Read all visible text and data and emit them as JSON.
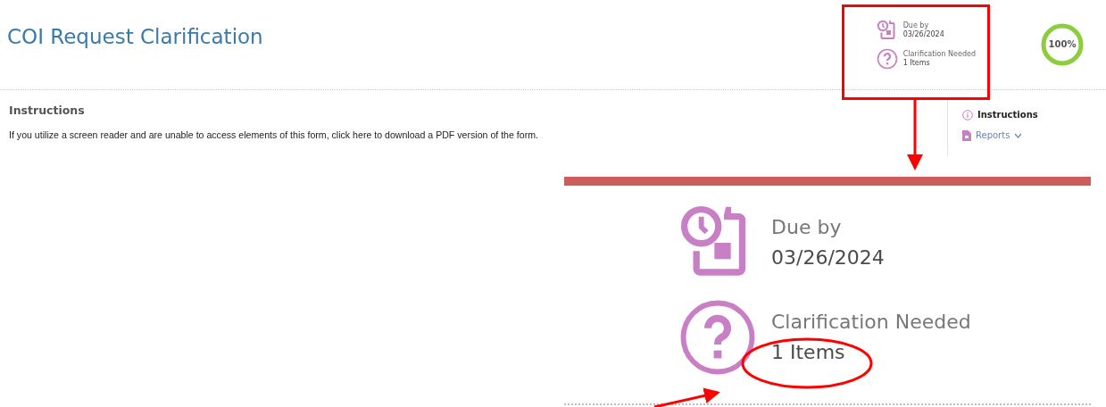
{
  "page": {
    "title": "COI Request Clarification"
  },
  "status": [
    {
      "kind": "due",
      "label": "Due by",
      "value": "03/26/2024"
    },
    {
      "kind": "clarification",
      "label": "Clarification Needed",
      "value": "1 Items"
    }
  ],
  "progress": {
    "label": "100%",
    "level": 1
  },
  "instructions": {
    "heading": "Instructions",
    "text": "If you utilize a screen reader and are unable to access elements of this form, click here to download a PDF version of the form."
  },
  "sidebar": {
    "items": [
      {
        "kind": "info",
        "label": "Instructions",
        "selected": true
      },
      {
        "kind": "report",
        "label": "Reports",
        "selected": false,
        "expanded": false
      }
    ]
  },
  "zoom_inset": {
    "status": [
      {
        "kind": "due",
        "label": "Due by",
        "value": "03/26/2024"
      },
      {
        "kind": "clarification",
        "label": "Clarification Needed",
        "value": "1 Items"
      }
    ]
  }
}
